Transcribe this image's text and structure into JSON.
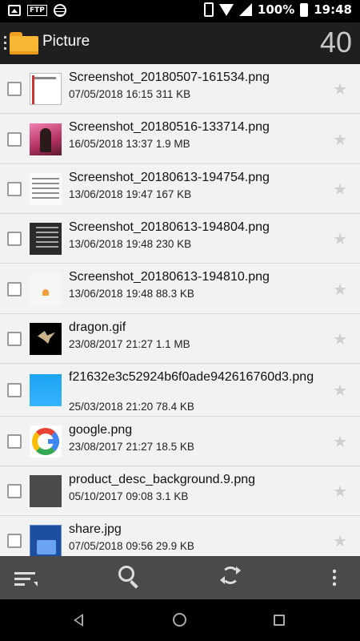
{
  "status_bar": {
    "ftp_label": "FTP",
    "battery": "100%",
    "time": "19:48",
    "icons": [
      "gallery-icon",
      "ftp-icon",
      "globe-icon",
      "vibrate-icon",
      "wifi-icon",
      "signal-icon",
      "battery-charging-icon"
    ]
  },
  "app_bar": {
    "title": "Picture",
    "count": "40",
    "icon": "folder-icon"
  },
  "files": [
    {
      "name": "Screenshot_20180507-161534.png",
      "datetime": "07/05/2018 16:15",
      "size": "311 KB",
      "thumb": "t-shot1"
    },
    {
      "name": "Screenshot_20180516-133714.png",
      "datetime": "16/05/2018 13:37",
      "size": "1.9 MB",
      "thumb": "t-pink"
    },
    {
      "name": "Screenshot_20180613-194754.png",
      "datetime": "13/06/2018 19:47",
      "size": "167 KB",
      "thumb": "t-list"
    },
    {
      "name": "Screenshot_20180613-194804.png",
      "datetime": "13/06/2018 19:48",
      "size": "230 KB",
      "thumb": "t-dark"
    },
    {
      "name": "Screenshot_20180613-194810.png",
      "datetime": "13/06/2018 19:48",
      "size": "88.3 KB",
      "thumb": "t-small"
    },
    {
      "name": "dragon.gif",
      "datetime": "23/08/2017 21:27",
      "size": "1.1 MB",
      "thumb": "t-dragon"
    },
    {
      "name": "f21632e3c52924b6f0ade942616760d3.png",
      "datetime": "25/03/2018 21:20",
      "size": "78.4 KB",
      "thumb": "t-sky"
    },
    {
      "name": "google.png",
      "datetime": "23/08/2017 21:27",
      "size": "18.5 KB",
      "thumb": "t-google"
    },
    {
      "name": "product_desc_background.9.png",
      "datetime": "05/10/2017 09:08",
      "size": "3.1 KB",
      "thumb": "t-gray"
    },
    {
      "name": "share.jpg",
      "datetime": "07/05/2018 09:56",
      "size": "29.9 KB",
      "thumb": "t-share"
    }
  ],
  "toolbar": {
    "icons": [
      "sort-icon",
      "search-icon",
      "refresh-icon",
      "more-vert-icon"
    ]
  },
  "nav_bar": {
    "icons": [
      "back-icon",
      "home-icon",
      "recents-icon"
    ]
  },
  "colors": {
    "app_bar": "#1f1f1f",
    "list_bg": "#f2f2f2",
    "toolbar": "#4a4a4a",
    "folder": "#f7b733"
  }
}
